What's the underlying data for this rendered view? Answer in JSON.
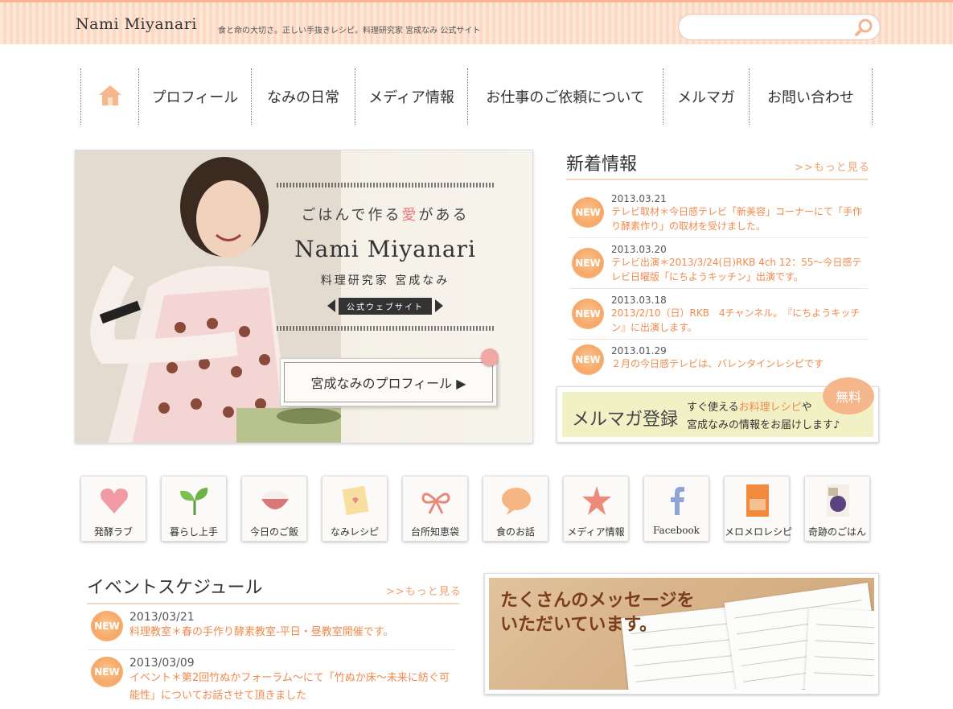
{
  "header": {
    "logo": "Nami Miyanari",
    "tagline": "食と命の大切さ。正しい手抜きレシピ。料理研究家 宮成なみ 公式サイト",
    "search_placeholder": ""
  },
  "nav": {
    "items": [
      {
        "label": "プロフィール"
      },
      {
        "label": "なみの日常"
      },
      {
        "label": "メディア情報"
      },
      {
        "label": "お仕事のご依頼について"
      },
      {
        "label": "メルマガ"
      },
      {
        "label": "お問い合わせ"
      }
    ]
  },
  "hero": {
    "catch_pre": "ごはんで作る",
    "catch_love": "愛",
    "catch_post": "がある",
    "name": "Nami Miyanari",
    "subtitle": "料理研究家 宮成なみ",
    "ribbon": "公式ウェブサイト",
    "profile_button": "宮成なみのプロフィール ▶"
  },
  "news": {
    "title": "新着情報",
    "more": ">>もっと見る",
    "badge": "NEW",
    "items": [
      {
        "date": "2013.03.21",
        "text": "テレビ取材＊今日感テレビ「新美容」コーナーにて「手作り酵素作り」の取材を受けました。"
      },
      {
        "date": "2013.03.20",
        "text": "テレビ出演＊2013/3/24(日)RKB 4ch 12：55～今日感テレビ日曜版「にちようキッチン」出演です。"
      },
      {
        "date": "2013.03.18",
        "text": "2013/2/10（日）RKB　4チャンネル。　『にちようキッチン』に出演します。"
      },
      {
        "date": "2013.01.29",
        "text": "２月の今日感テレビは、バレンタインレシピです"
      }
    ]
  },
  "mail_magazine": {
    "title": "メルマガ登録",
    "line1_pre": "すぐ使える",
    "line1_hl": "お料理レシピ",
    "line1_post": "や",
    "line2": "宮成なみの情報をお届けします♪",
    "free_badge": "無料"
  },
  "tiles": [
    {
      "label": "発酵ラブ",
      "icon": "heart-icon"
    },
    {
      "label": "暮らし上手",
      "icon": "leaf-icon"
    },
    {
      "label": "今日のご飯",
      "icon": "rice-bowl-icon"
    },
    {
      "label": "なみレシピ",
      "icon": "recipe-card-icon"
    },
    {
      "label": "台所知恵袋",
      "icon": "ribbon-icon"
    },
    {
      "label": "食のお話",
      "icon": "speech-bubble-icon"
    },
    {
      "label": "メディア情報",
      "icon": "star-icon"
    },
    {
      "label": "Facebook",
      "icon": "facebook-icon"
    },
    {
      "label": "メロメロレシピ",
      "icon": "book-icon"
    },
    {
      "label": "奇跡のごはん",
      "icon": "book-cover-icon"
    }
  ],
  "events": {
    "title": "イベントスケジュール",
    "more": ">>もっと見る",
    "badge": "NEW",
    "items": [
      {
        "date": "2013/03/21",
        "text": "料理教室＊春の手作り酵素教室-平日・昼教室開催です。"
      },
      {
        "date": "2013/03/09",
        "text": "イベント＊第2回竹ぬかフォーラム～にて「竹ぬか床～未来に紡ぐ可能性」についてお話させて頂きました"
      }
    ]
  },
  "messages_banner": {
    "line1": "たくさんのメッセージを",
    "line2": "いただいています。"
  },
  "colors": {
    "accent": "#f08a4f",
    "header_stripe": "#fde6d6",
    "mm_bg": "#f2f1c6"
  }
}
